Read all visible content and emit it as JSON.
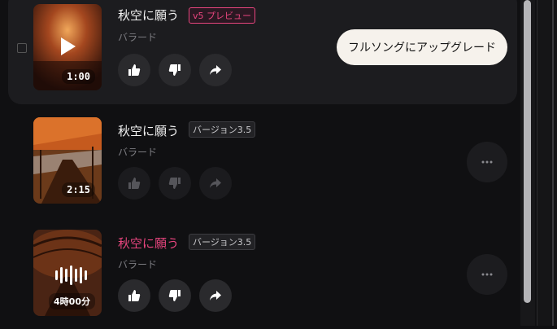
{
  "songs": [
    {
      "title": "秋空に願う",
      "badge": "v5 プレビュー",
      "genre": "バラード",
      "duration": "1:00",
      "upgrade_label": "フルソングにアップグレード",
      "state": "playing"
    },
    {
      "title": "秋空に願う",
      "badge": "バージョン3.5",
      "genre": "バラード",
      "duration": "2:15",
      "state": "idle"
    },
    {
      "title": "秋空に願う",
      "badge": "バージョン3.5",
      "genre": "バラード",
      "duration": "4時00分",
      "state": "selected"
    }
  ],
  "icons": {
    "like": "thumbs-up-icon",
    "dislike": "thumbs-down-icon",
    "share": "share-icon",
    "more": "more-dots-icon",
    "play": "play-icon",
    "wave": "waveform-icon"
  },
  "colors": {
    "accent": "#e8457e",
    "background": "#101012",
    "row_active": "#1c1c1f",
    "upgrade_bg": "#f6f2ec"
  }
}
